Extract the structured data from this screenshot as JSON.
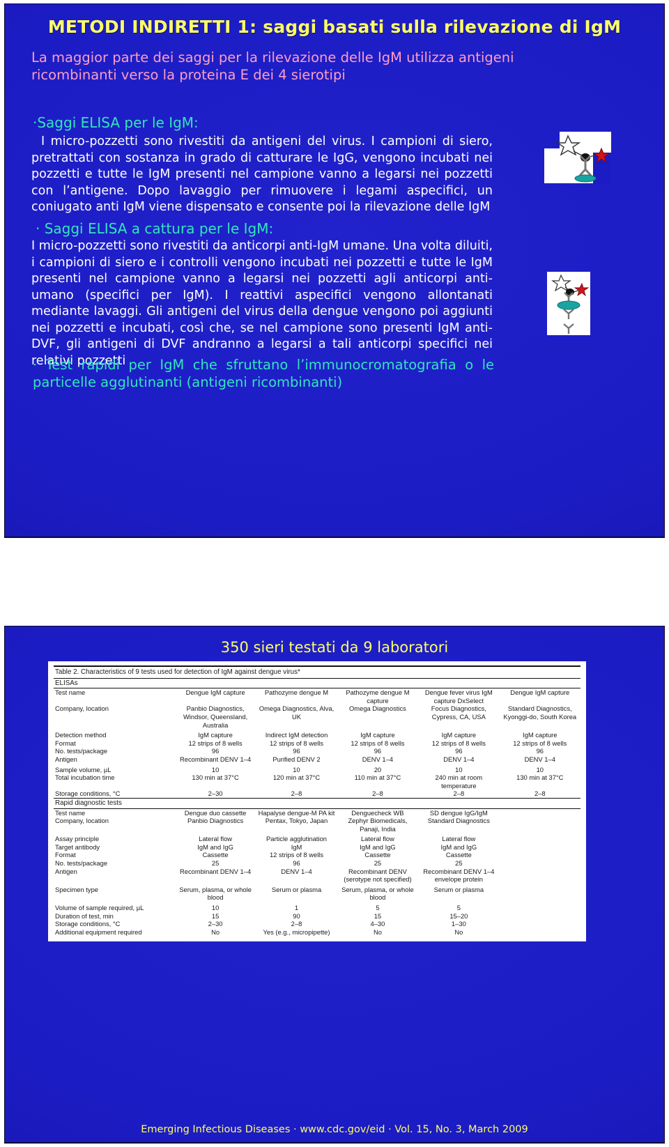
{
  "slide1": {
    "title": "METODI INDIRETTI 1: saggi basati sulla rilevazione di IgM",
    "subtitle": "La maggior parte dei saggi per la rilevazione delle IgM utilizza antigeni ricombinanti verso la proteina E dei 4 sierotipi",
    "elisa_head": "·Saggi ELISA per le  IgM:",
    "elisa_para": "I micro-pozzetti sono rivestiti da antigeni del virus. I campioni di siero, pretrattati con sostanza in grado di catturare le IgG, vengono incubati nei pozzetti e tutte le IgM presenti nel campione vanno a legarsi nei pozzetti con l’antigene. Dopo lavaggio per rimuovere i legami aspecifici, un coniugato anti IgM viene dispensato e consente poi la rilevazione delle IgM",
    "capture_head": "· Saggi ELISA a cattura per le IgM:",
    "capture_para": "I micro-pozzetti sono rivestiti da anticorpi anti-IgM umane. Una volta diluiti, i campioni di siero e i controlli vengono incubati nei pozzetti e tutte le IgM presenti nel campione vanno a legarsi nei pozzetti agli anticorpi anti-umano (specifici per IgM). I reattivi aspecifici vengono allontanati mediante lavaggi. Gli antigeni del virus della dengue vengono poi aggiunti nei pozzetti e incubati, così che, se nel campione sono presenti IgM anti-DVF, gli antigeni di DVF andranno a legarsi a tali anticorpi specifici nei relativi pozzetti",
    "rapid_text": "· Test rapidi per IgM che sfruttano l’immunocromatografia o le particelle agglutinanti (antigeni ricombinanti)",
    "colors": {
      "title": "#ffff66",
      "subtitle": "#ff9ec4",
      "bullet_head": "#33e6bb",
      "body": "#ffffff",
      "background": "#1c1cc4"
    }
  },
  "slide2": {
    "title": "350 sieri  testati da 9 laboratori",
    "footer": "Emerging Infectious Diseases · www.cdc.gov/eid · Vol. 15, No. 3, March 2009",
    "table": {
      "caption": "Table 2. Characteristics of 9 tests used for detection of IgM against dengue virus*",
      "section_elisas": "ELISAs",
      "section_rapid": "Rapid diagnostic tests",
      "elisa_rows": [
        {
          "label": "Test name",
          "values": [
            "Dengue IgM capture",
            "Pathozyme dengue M",
            "Pathozyme dengue M capture",
            "Dengue fever virus IgM capture DxSelect",
            "Dengue IgM capture"
          ]
        },
        {
          "label": "Company, location",
          "values": [
            "Panbio Diagnostics, Windsor, Queensland, Australia",
            "Omega Diagnostics, Alva, UK",
            "Omega Diagnostics",
            "Focus Diagnostics, Cypress, CA, USA",
            "Standard Diagnostics, Kyonggi-do, South Korea"
          ]
        },
        {
          "label": "Detection method",
          "values": [
            "IgM capture",
            "Indirect IgM detection",
            "IgM capture",
            "IgM capture",
            "IgM capture"
          ]
        },
        {
          "label": "Format",
          "values": [
            "12 strips of 8 wells",
            "12 strips of 8 wells",
            "12 strips of 8 wells",
            "12 strips of 8 wells",
            "12 strips of 8 wells"
          ]
        },
        {
          "label": "No. tests/package",
          "values": [
            "96",
            "96",
            "96",
            "96",
            "96"
          ]
        },
        {
          "label": "Antigen",
          "values": [
            "Recombinant DENV 1–4",
            "Purified DENV 2",
            "DENV 1–4",
            "DENV 1–4",
            "DENV 1–4"
          ]
        },
        {
          "label": "Sample volume, µL",
          "values": [
            "10",
            "10",
            "20",
            "10",
            "10"
          ]
        },
        {
          "label": "Total incubation time",
          "values": [
            "130 min at 37°C",
            "120 min at 37°C",
            "110 min at 37°C",
            "240 min at room temperature",
            "130 min at 37°C"
          ]
        },
        {
          "label": "Storage conditions, °C",
          "values": [
            "2–30",
            "2–8",
            "2–8",
            "2–8",
            "2–8"
          ]
        }
      ],
      "rapid_rows": [
        {
          "label": "Test name",
          "values": [
            "Dengue duo cassette",
            "Hapalyse dengue-M PA kit",
            "Denguecheck WB",
            "SD dengue IgG/IgM"
          ]
        },
        {
          "label": "Company, location",
          "values": [
            "Panbio Diagnostics",
            "Pentax, Tokyo, Japan",
            "Zephyr Biomedicals, Panaji, India",
            "Standard Diagnostics"
          ]
        },
        {
          "label": "Assay principle",
          "values": [
            "Lateral flow",
            "Particle agglutination",
            "Lateral flow",
            "Lateral flow"
          ]
        },
        {
          "label": "Target antibody",
          "values": [
            "IgM and IgG",
            "IgM",
            "IgM and IgG",
            "IgM and IgG"
          ]
        },
        {
          "label": "Format",
          "values": [
            "Cassette",
            "12 strips of 8 wells",
            "Cassette",
            "Cassette"
          ]
        },
        {
          "label": "No. tests/package",
          "values": [
            "25",
            "96",
            "25",
            "25"
          ]
        },
        {
          "label": "Antigen",
          "values": [
            "Recombinant DENV 1–4",
            "DENV 1–4",
            "Recombinant DENV (serotype not specified)",
            "Recombinant DENV 1–4 envelope protein"
          ]
        },
        {
          "label": "Specimen type",
          "values": [
            "Serum, plasma, or whole blood",
            "Serum or plasma",
            "Serum, plasma, or whole blood",
            "Serum or plasma"
          ]
        },
        {
          "label": "Volume of sample required, µL",
          "values": [
            "10",
            "1",
            "5",
            "5"
          ]
        },
        {
          "label": "Duration of test, min",
          "values": [
            "15",
            "90",
            "15",
            "15–20"
          ]
        },
        {
          "label": "Storage conditions, °C",
          "values": [
            "2–30",
            "2–8",
            "4–30",
            "1–30"
          ]
        },
        {
          "label": "Additional equipment required",
          "values": [
            "No",
            "Yes (e.g., micropipette)",
            "No",
            "No"
          ]
        }
      ]
    }
  },
  "diagrams": {
    "elisa": "elisa-assay-diagram",
    "capture": "capture-elisa-assay-diagram"
  }
}
